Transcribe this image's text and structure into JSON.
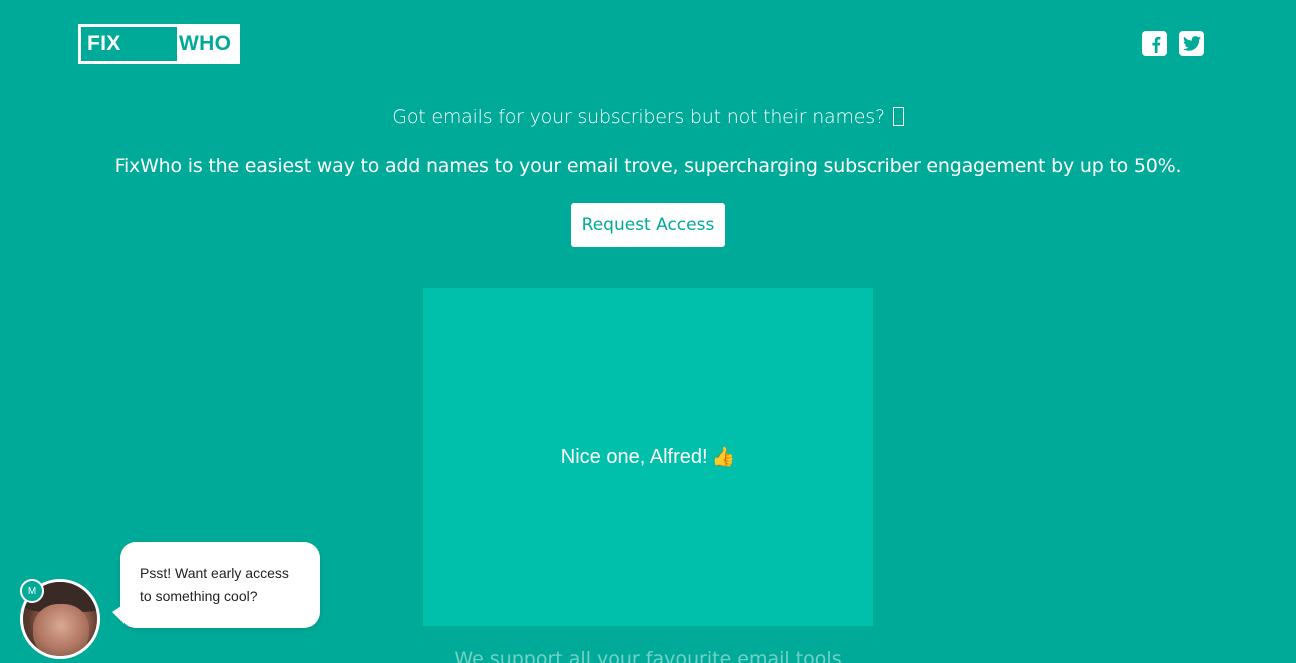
{
  "header": {
    "logo_left": "FIX",
    "logo_right": "WHO",
    "social": [
      {
        "name": "facebook",
        "icon": "facebook-icon"
      },
      {
        "name": "twitter",
        "icon": "twitter-icon"
      }
    ]
  },
  "hero": {
    "tagline": "Got emails for your subscribers but not their names?",
    "description": "FixWho is the easiest way to add names to your email trove, supercharging subscriber engagement by up to 50%.",
    "cta_label": "Request Access"
  },
  "demo": {
    "text": "Nice one, Alfred!",
    "emoji": "👍"
  },
  "support_text": "We support all your favourite email tools",
  "chat": {
    "badge": "M",
    "message_line1": "Psst! Want early access",
    "message_line2": "to something cool?"
  },
  "colors": {
    "background": "#00aa98",
    "panel": "#00bfab",
    "text": "#ffffff"
  }
}
